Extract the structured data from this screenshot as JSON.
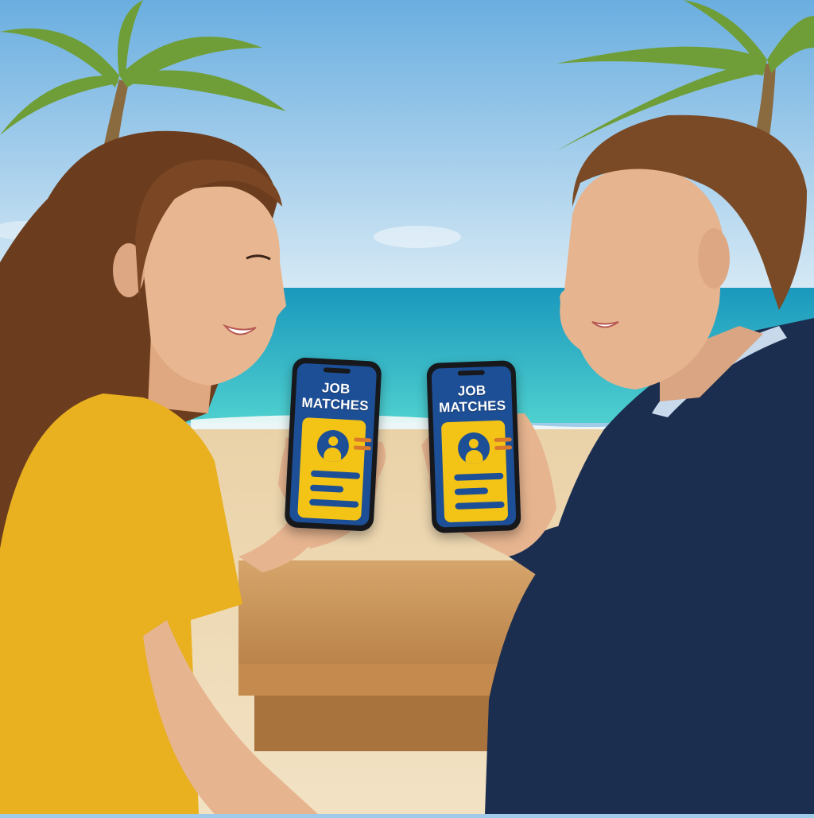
{
  "scene": {
    "setting": "tropical beach",
    "colors": {
      "sky_top": "#6aaee0",
      "sky_bottom": "#d6e9f5",
      "sea": "#1fb2c4",
      "sand": "#ecd6b0",
      "table": "#c9945a",
      "shirt": "#e9b020",
      "suit": "#1b2e4f",
      "hair_woman": "#6b3d1e",
      "hair_man": "#7a4a26",
      "skin": "#e6b48f",
      "palm_leaf": "#6f9e38",
      "palm_trunk": "#8a6a3f"
    }
  },
  "phones": [
    {
      "title_line1": "JOB",
      "title_line2": "MATCHES",
      "screen_color": "#1d4f96",
      "card_color": "#f3c316",
      "avatar_icon": "user-avatar-icon"
    },
    {
      "title_line1": "JOB",
      "title_line2": "MATCHES",
      "screen_color": "#1d4f96",
      "card_color": "#f3c316",
      "avatar_icon": "user-avatar-icon"
    }
  ]
}
